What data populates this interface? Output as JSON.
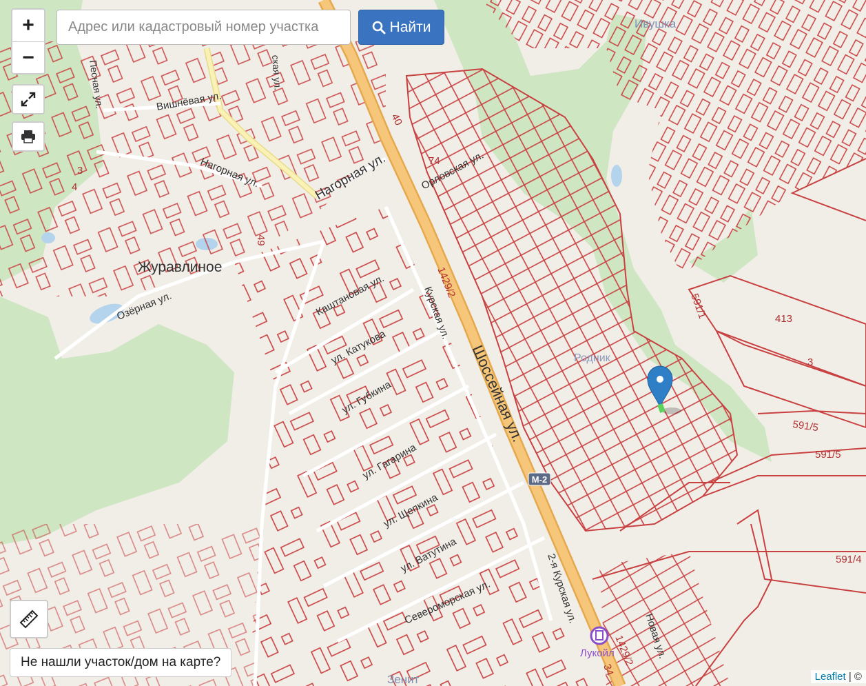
{
  "search": {
    "placeholder": "Адрес или кадастровый номер участка",
    "button_label": "Найти"
  },
  "controls": {
    "zoom_in": "+",
    "zoom_out": "−"
  },
  "not_found_label": "Не нашли участок/дом на карте?",
  "attribution": {
    "link": "Leaflet",
    "sep": " | ©"
  },
  "map": {
    "places": {
      "zhuravlinoe": "Журавлиное",
      "ivushka": "Ивушка",
      "rodnik": "Родник",
      "zenit": "Зенит",
      "lukoil": "Лукойл"
    },
    "streets": {
      "shosseynaya": "Шоссейная ул.",
      "nagornaya1": "Нагорная ул.",
      "nagornaya2": "Нагорная ул.",
      "vishnevaya": "Вишнёвая ул.",
      "pesnaya": "Песная ул.",
      "ozernaya": "Озёрная ул.",
      "kashtanovaya": "Каштановая ул.",
      "kurskaya": "Курская ул.",
      "katukova": "ул. Катукова",
      "gubkina": "ул. Губкина",
      "gagarina": "ул. Гагарина",
      "shchepkina": "ул. Щепкина",
      "vatutina": "ул. Ватутина",
      "severomorskaya": "Североморская ул.",
      "kurskaya2": "2-я Курская ул.",
      "novaya": "Новая ул.",
      "orlovskaya": "Орловская ул.",
      "sk": "ская ул."
    },
    "road_badge": "М-2",
    "numbers": {
      "n1429_2a": "1429/2",
      "n1429_2b": "1429/2",
      "n413": "413",
      "n3": "3",
      "n591_1": "591/1",
      "n591_5a": "591/5",
      "n591_5b": "591/5",
      "n591_4": "591/4",
      "n40": "40",
      "n74": "74",
      "n49": "49",
      "n3b": "3",
      "n4": "4",
      "n34": "34"
    }
  }
}
